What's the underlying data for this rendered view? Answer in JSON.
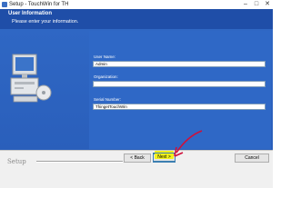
{
  "window": {
    "title": "Setup - TouchWin for TH",
    "controls": [
      "minimize-icon",
      "maximize-icon",
      "close-icon"
    ]
  },
  "header": {
    "title": "User Information",
    "subtitle": "Please enter your information."
  },
  "form": {
    "user_name": {
      "label": "User Name:",
      "value": "Admin"
    },
    "organization": {
      "label": "Organization:",
      "value": ""
    },
    "serial_number": {
      "label": "Serial Number:",
      "value": "ThingetTouchWin"
    }
  },
  "footer": {
    "brand": "Setup",
    "back_label": "< Back",
    "next_label": "Next >",
    "cancel_label": "Cancel"
  },
  "colors": {
    "header_bg": "#1f4ea8",
    "panel_bg": "#2f68c6",
    "highlight": "#f1f21b",
    "annotation_arrow": "#d0103a"
  }
}
